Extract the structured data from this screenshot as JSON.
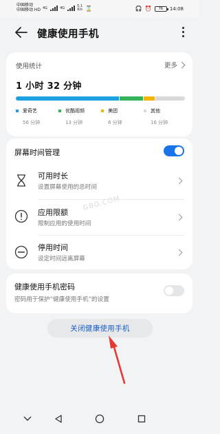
{
  "status_bar": {
    "carrier1": "中国移动",
    "carrier2": "中国移动 HD",
    "net1": "4G",
    "net2": "4G",
    "speed": "5.1\nK/s",
    "battery": "76",
    "time": "14:08"
  },
  "header": {
    "title": "健康使用手机"
  },
  "stats": {
    "label": "使用统计",
    "more": "更多",
    "total": "1 小时 32 分钟",
    "apps": [
      {
        "name": "爱奇艺",
        "duration": "56 分钟",
        "minutes": 56,
        "color": "#1ea1e0"
      },
      {
        "name": "优酷视频",
        "duration": "13 分钟",
        "minutes": 13,
        "color": "#34b35a"
      },
      {
        "name": "美团",
        "duration": "6 分钟",
        "minutes": 6,
        "color": "#f4b400"
      },
      {
        "name": "其他",
        "duration": "16 分钟",
        "minutes": 16,
        "color": "#d9d9d9"
      }
    ]
  },
  "manage": {
    "title": "屏幕时间管理",
    "toggle_on": true,
    "items": [
      {
        "title": "可用时长",
        "sub": "设置屏幕使用的总时间",
        "icon": "hourglass-icon"
      },
      {
        "title": "应用限额",
        "sub": "限制应用的使用时间",
        "icon": "info-circle-icon"
      },
      {
        "title": "停用时间",
        "sub": "设定时间远离屏幕",
        "icon": "minus-circle-icon"
      }
    ]
  },
  "password": {
    "title": "健康使用手机密码",
    "sub": "密码用于保护“健康使用手机”的设置",
    "toggle_on": false
  },
  "close_button": "关闭健康使用手机",
  "watermark": "GBO.COM",
  "colors": {
    "accent": "#1a73e8",
    "annotation_arrow": "#e53935"
  }
}
